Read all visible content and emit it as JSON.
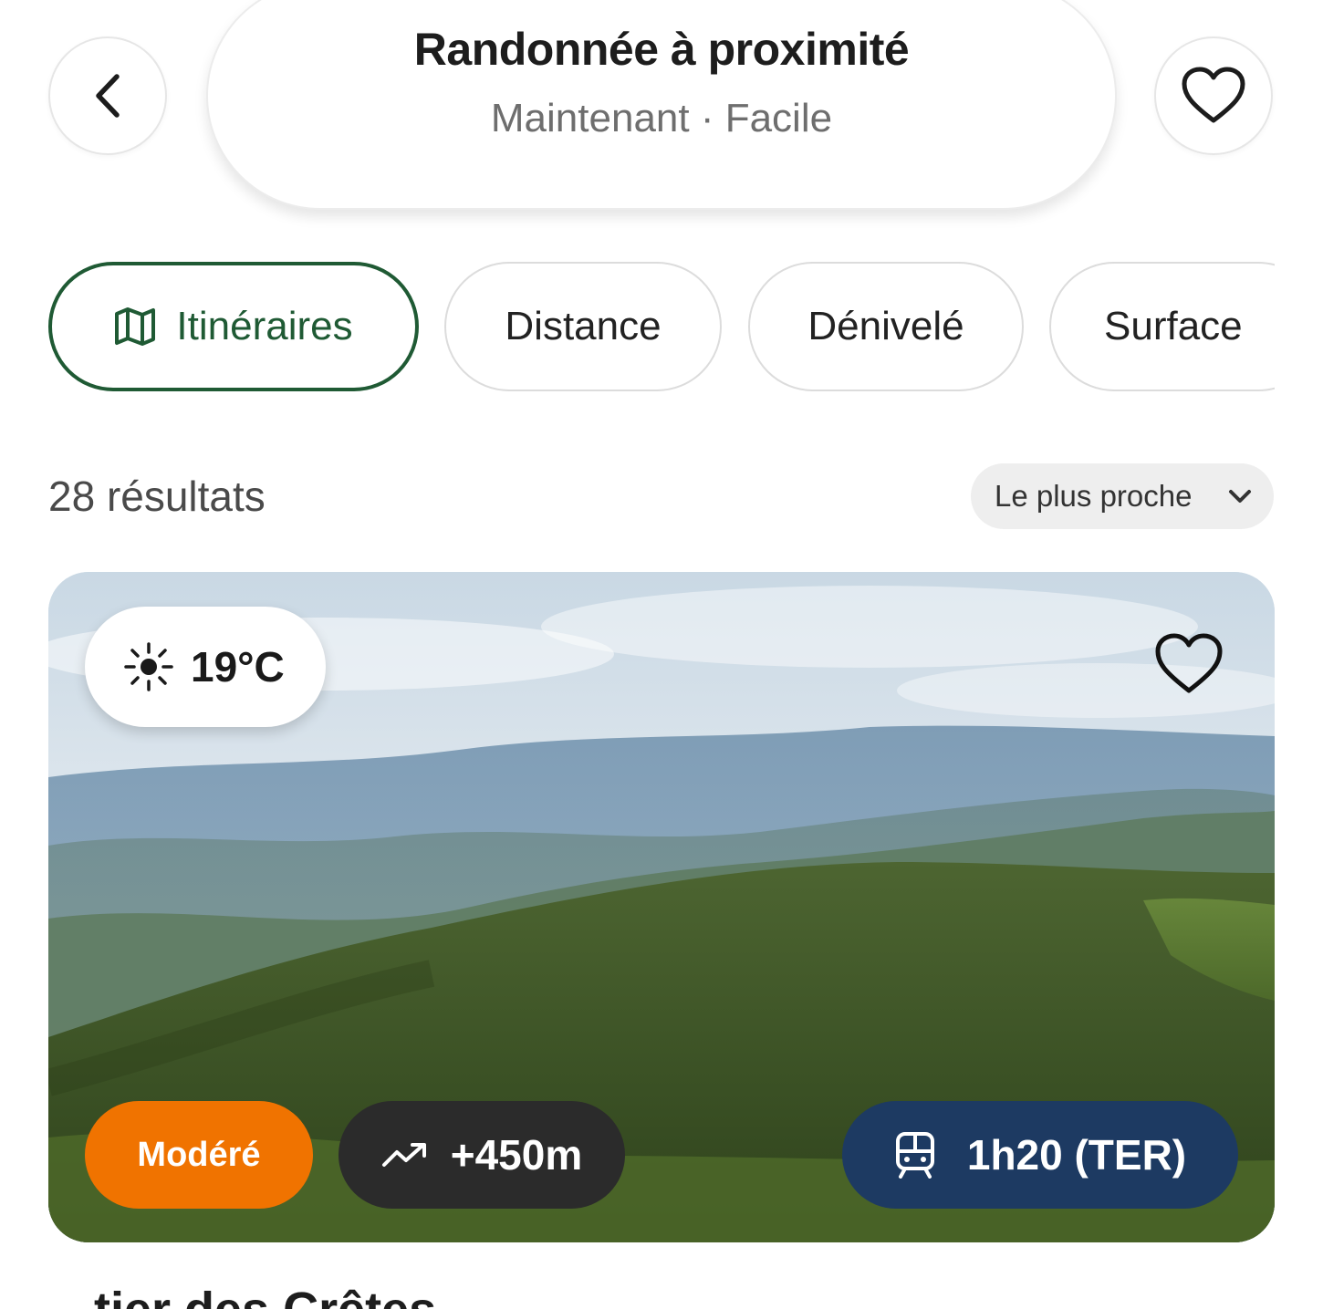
{
  "header": {
    "back_icon": "chevron-left-icon",
    "title": "Randonnée à proximité",
    "subtitle": "Maintenant · Facile",
    "favorite_icon": "heart-icon"
  },
  "filters": [
    {
      "label": "Itinéraires",
      "icon": "map-icon",
      "active": true
    },
    {
      "label": "Distance",
      "active": false
    },
    {
      "label": "Dénivelé",
      "active": false
    },
    {
      "label": "Surface",
      "active": false
    }
  ],
  "results": {
    "count_label": "28 résultats",
    "sort_label": "Le plus proche",
    "sort_icon": "chevron-down-icon"
  },
  "card": {
    "image": "mountain-forest-landscape",
    "weather": {
      "icon": "sun-icon",
      "temperature": "19°C"
    },
    "favorite_icon": "heart-outline-icon",
    "difficulty": "Modéré",
    "elevation": {
      "icon": "trending-up-icon",
      "value": "+450m"
    },
    "transit": {
      "icon": "train-icon",
      "value": "1h20 (TER)"
    },
    "next_title": "...tier des Crêtes"
  },
  "colors": {
    "accent_green": "#1f5a34",
    "difficulty_orange": "#f07300",
    "elevation_dark": "#2b2b2b",
    "transit_navy": "#1d3a62"
  }
}
